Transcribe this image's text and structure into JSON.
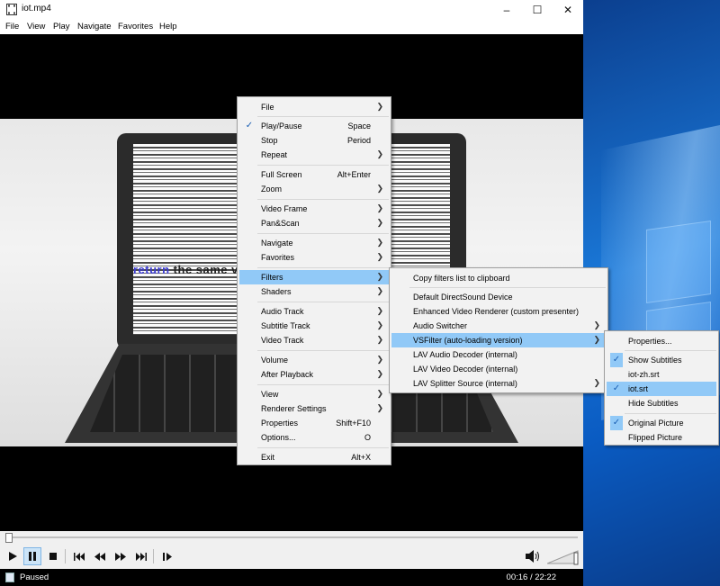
{
  "window": {
    "title": "iot.mp4"
  },
  "menubar": [
    "File",
    "View",
    "Play",
    "Navigate",
    "Favorites",
    "Help"
  ],
  "video": {
    "overlay_text_left": "return",
    "overlay_text_rest": " the same value, so"
  },
  "main_menu": {
    "items": [
      {
        "label": "File",
        "key": "",
        "submenu": true
      },
      {
        "label": "Play/Pause",
        "key": "Space",
        "checked": true
      },
      {
        "label": "Stop",
        "key": "Period"
      },
      {
        "label": "Repeat",
        "key": "",
        "submenu": true
      },
      {
        "label": "Full Screen",
        "key": "Alt+Enter"
      },
      {
        "label": "Zoom",
        "key": "",
        "submenu": true
      },
      {
        "label": "Video Frame",
        "key": "",
        "submenu": true
      },
      {
        "label": "Pan&Scan",
        "key": "",
        "submenu": true
      },
      {
        "label": "Navigate",
        "key": "",
        "submenu": true
      },
      {
        "label": "Favorites",
        "key": "",
        "submenu": true
      },
      {
        "label": "Filters",
        "key": "",
        "submenu": true,
        "highlighted": true
      },
      {
        "label": "Shaders",
        "key": "",
        "submenu": true
      },
      {
        "label": "Audio Track",
        "key": "",
        "submenu": true
      },
      {
        "label": "Subtitle Track",
        "key": "",
        "submenu": true
      },
      {
        "label": "Video Track",
        "key": "",
        "submenu": true
      },
      {
        "label": "Volume",
        "key": "",
        "submenu": true
      },
      {
        "label": "After Playback",
        "key": "",
        "submenu": true
      },
      {
        "label": "View",
        "key": "",
        "submenu": true
      },
      {
        "label": "Renderer Settings",
        "key": "",
        "submenu": true
      },
      {
        "label": "Properties",
        "key": "Shift+F10"
      },
      {
        "label": "Options...",
        "key": "O"
      },
      {
        "label": "Exit",
        "key": "Alt+X"
      }
    ]
  },
  "filters_menu": {
    "items": [
      {
        "label": "Copy filters list to clipboard"
      },
      {
        "label": "Default DirectSound Device"
      },
      {
        "label": "Enhanced Video Renderer (custom presenter)"
      },
      {
        "label": "Audio Switcher",
        "submenu": true
      },
      {
        "label": "VSFilter (auto-loading version)",
        "submenu": true,
        "highlighted": true
      },
      {
        "label": "LAV Audio Decoder (internal)"
      },
      {
        "label": "LAV Video Decoder (internal)"
      },
      {
        "label": "LAV Splitter Source (internal)",
        "submenu": true
      }
    ]
  },
  "vsfilter_menu": {
    "items": [
      {
        "label": "Properties..."
      },
      {
        "label": "Show Subtitles",
        "checked": true
      },
      {
        "label": "iot-zh.srt"
      },
      {
        "label": "iot.srt",
        "checked": true,
        "highlighted": true
      },
      {
        "label": "Hide Subtitles"
      },
      {
        "label": "Original Picture",
        "checked": true
      },
      {
        "label": "Flipped Picture"
      }
    ]
  },
  "status": {
    "state": "Paused",
    "time": "00:16 / 22:22"
  },
  "icons": {
    "check": "checkmark-icon",
    "arrow": "chevron-right-icon"
  }
}
